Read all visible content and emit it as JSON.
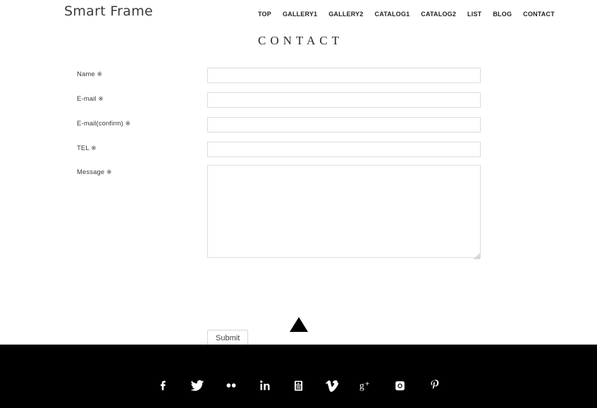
{
  "header": {
    "brand": "Smart Frame",
    "nav": [
      {
        "label": "TOP",
        "name": "nav-item-top"
      },
      {
        "label": "GALLERY1",
        "name": "nav-item-gallery1"
      },
      {
        "label": "GALLERY2",
        "name": "nav-item-gallery2"
      },
      {
        "label": "CATALOG1",
        "name": "nav-item-catalog1"
      },
      {
        "label": "CATALOG2",
        "name": "nav-item-catalog2"
      },
      {
        "label": "LIST",
        "name": "nav-item-list"
      },
      {
        "label": "BLOG",
        "name": "nav-item-blog"
      },
      {
        "label": "CONTACT",
        "name": "nav-item-contact"
      }
    ]
  },
  "page": {
    "title": "CONTACT"
  },
  "form": {
    "fields": [
      {
        "label": "Name",
        "required_mark": "※",
        "value": "",
        "placeholder": "",
        "type": "text"
      },
      {
        "label": "E-mail",
        "required_mark": "※",
        "value": "",
        "placeholder": "",
        "type": "text"
      },
      {
        "label": "E-mail(confirm)",
        "required_mark": "※",
        "value": "",
        "placeholder": "",
        "type": "text"
      },
      {
        "label": "TEL",
        "required_mark": "※",
        "value": "",
        "placeholder": "",
        "type": "text"
      },
      {
        "label": "Message",
        "required_mark": "※",
        "value": "",
        "placeholder": "",
        "type": "textarea"
      }
    ],
    "submit_label": "Submit"
  },
  "scroll_top": {
    "icon": "triangle-up-icon"
  },
  "footer": {
    "social": [
      {
        "name": "facebook-icon",
        "label": "Facebook"
      },
      {
        "name": "twitter-icon",
        "label": "Twitter"
      },
      {
        "name": "flickr-icon",
        "label": "Flickr"
      },
      {
        "name": "linkedin-icon",
        "label": "LinkedIn"
      },
      {
        "name": "youtube-icon",
        "label": "YouTube"
      },
      {
        "name": "vimeo-icon",
        "label": "Vimeo"
      },
      {
        "name": "googleplus-icon",
        "label": "Google Plus"
      },
      {
        "name": "instagram-icon",
        "label": "Instagram"
      },
      {
        "name": "pinterest-icon",
        "label": "Pinterest"
      }
    ]
  },
  "colors": {
    "page_background": "#ffffff",
    "footer_background": "#000000",
    "text": "#333333",
    "input_border": "#dcdcdc",
    "accent": "#000000"
  }
}
